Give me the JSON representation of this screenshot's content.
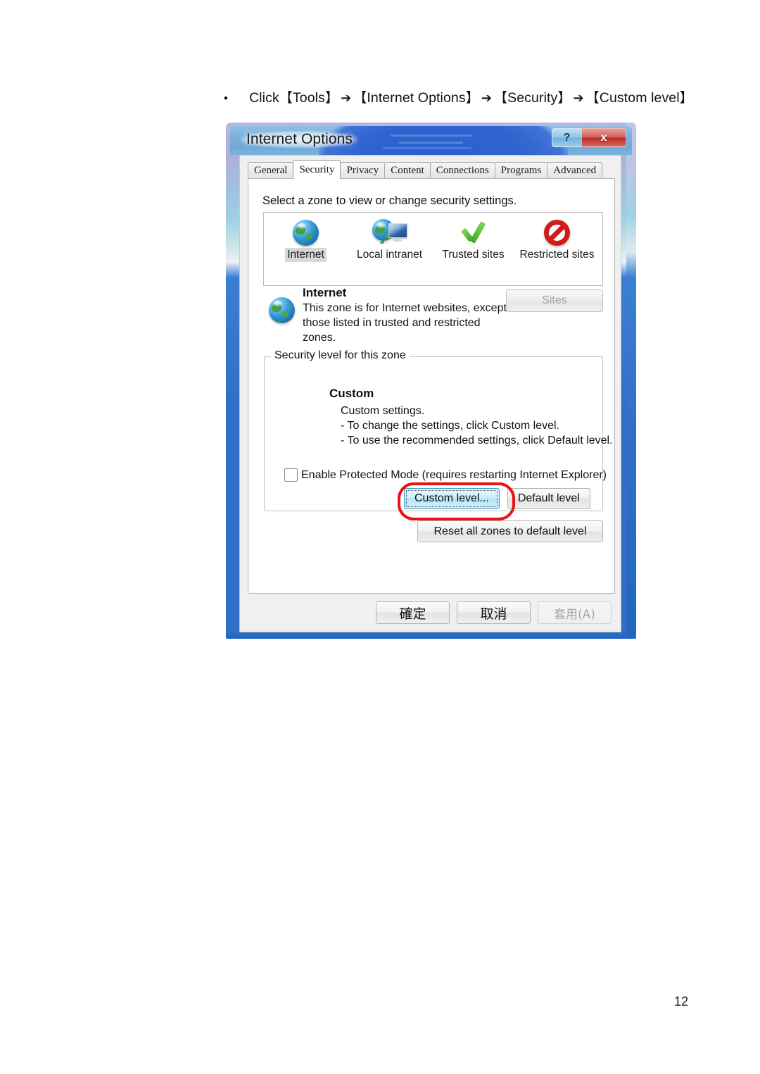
{
  "document": {
    "bullet_marker": "•",
    "instruction_parts": {
      "click": "Click",
      "open_bracket": "【",
      "close_bracket": "】",
      "arrow": "➔",
      "step1": "Tools",
      "step2": "Internet Options",
      "step3": "Security",
      "step4": "Custom level"
    },
    "page_number": "12"
  },
  "dialog": {
    "title": "Internet Options",
    "caption_buttons": [
      {
        "name": "help",
        "glyph": "?"
      },
      {
        "name": "close",
        "glyph": "x"
      }
    ],
    "tabs": [
      {
        "label": "General",
        "active": false
      },
      {
        "label": "Security",
        "active": true
      },
      {
        "label": "Privacy",
        "active": false
      },
      {
        "label": "Content",
        "active": false
      },
      {
        "label": "Connections",
        "active": false
      },
      {
        "label": "Programs",
        "active": false
      },
      {
        "label": "Advanced",
        "active": false
      }
    ],
    "security_tab": {
      "zone_instruction": "Select a zone to view or change security settings.",
      "zones": [
        {
          "label": "Internet",
          "icon": "globe-icon",
          "selected": true
        },
        {
          "label": "Local intranet",
          "icon": "globe-monitor-icon",
          "selected": false
        },
        {
          "label": "Trusted sites",
          "icon": "green-check-icon",
          "selected": false
        },
        {
          "label": "Restricted sites",
          "icon": "red-prohibition-icon",
          "selected": false
        }
      ],
      "selected_zone": {
        "name": "Internet",
        "description": "This zone is for Internet websites, except those listed in trusted and restricted zones.",
        "sites_button": "Sites",
        "sites_button_enabled": false
      },
      "security_level_group": {
        "legend": "Security level for this zone",
        "level_name": "Custom",
        "level_lines": [
          "Custom settings.",
          "- To change the settings, click Custom level.",
          "- To use the recommended settings, click Default level."
        ],
        "protected_mode_label": "Enable Protected Mode (requires restarting Internet Explorer)",
        "protected_mode_checked": false,
        "custom_level_button": "Custom level...",
        "default_level_button": "Default level"
      },
      "reset_button": "Reset all zones to default level"
    },
    "footer_buttons": [
      {
        "label": "確定",
        "enabled": true
      },
      {
        "label": "取消",
        "enabled": true
      },
      {
        "label": "套用(A)",
        "enabled": false
      }
    ]
  },
  "colors": {
    "annotation_red": "#e81313",
    "frame_blue": "#2f6fc9",
    "close_red": "#bb2a22"
  }
}
